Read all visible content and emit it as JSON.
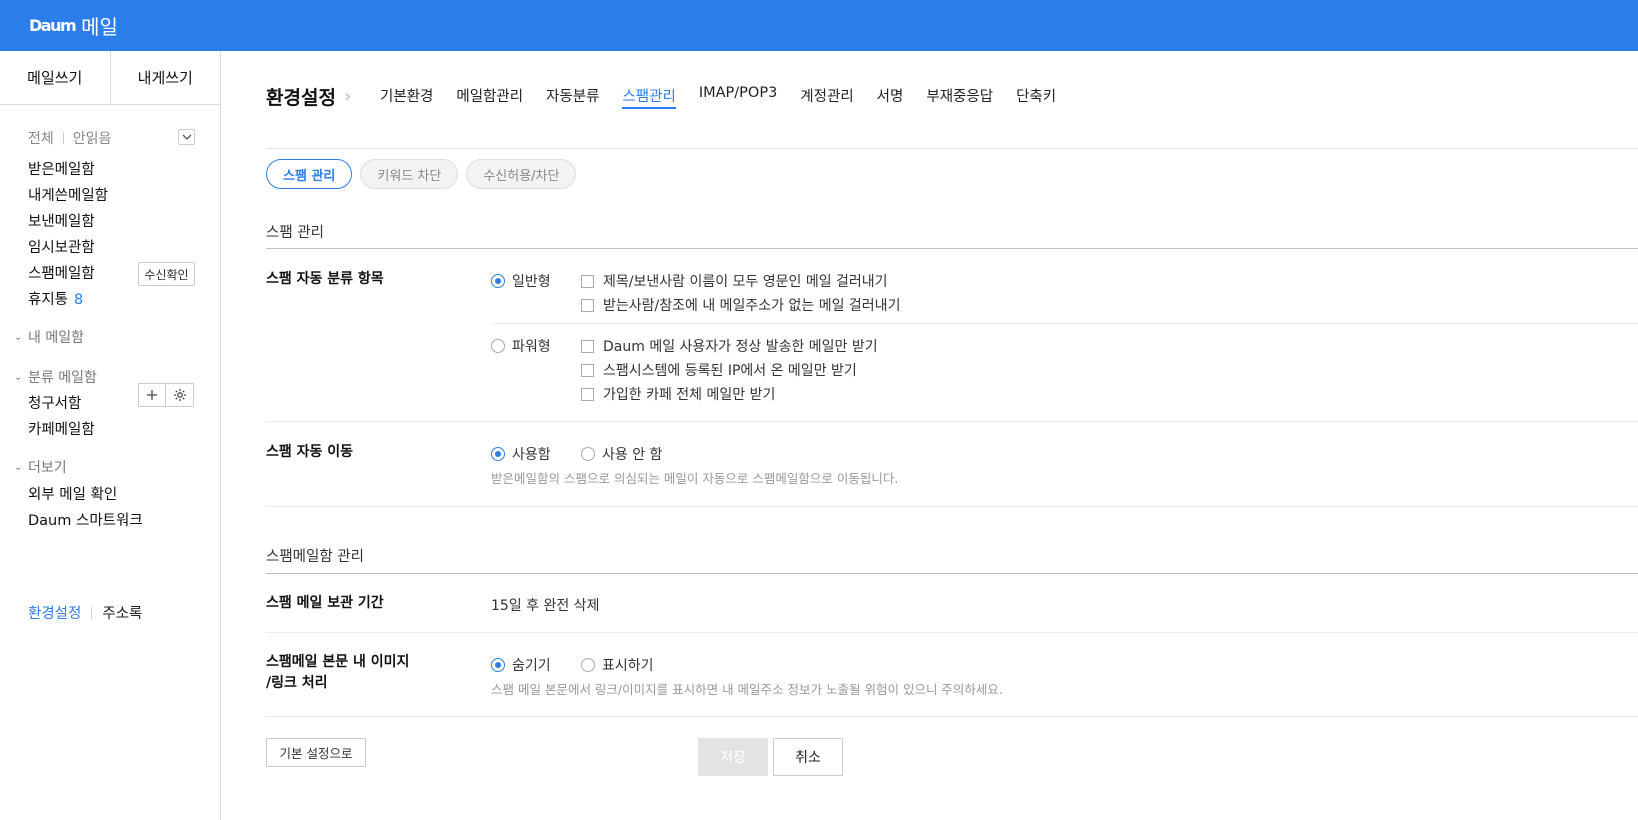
{
  "app": {
    "brand": "Daum",
    "title": "메일"
  },
  "sidebar": {
    "compose": [
      "메일쓰기",
      "내게쓰기"
    ],
    "filter": {
      "all": "전체",
      "unread": "안읽음"
    },
    "mailboxes": [
      {
        "label": "받은메일함"
      },
      {
        "label": "내게쓴메일함"
      },
      {
        "label": "보낸메일함"
      },
      {
        "label": "임시보관함"
      },
      {
        "label": "스팸메일함"
      },
      {
        "label": "휴지통",
        "count": "8"
      }
    ],
    "read_check": "수신확인",
    "my_mailbox": "내 메일함",
    "category_mailbox": "분류 메일함",
    "category_items": [
      "청구서함",
      "카페메일함"
    ],
    "more": "더보기",
    "more_items": [
      "외부 메일 확인",
      "Daum 스마트워크"
    ],
    "settings": "환경설정",
    "address_book": "주소록"
  },
  "header": {
    "title": "환경설정",
    "tabs": [
      "기본환경",
      "메일함관리",
      "자동분류",
      "스팸관리",
      "IMAP/POP3",
      "계정관리",
      "서명",
      "부재중응답",
      "단축키"
    ],
    "active_tab": "스팸관리"
  },
  "subtabs": [
    "스팸 관리",
    "키워드 차단",
    "수신허용/차단"
  ],
  "spam": {
    "section_title": "스팸 관리",
    "classify": {
      "label": "스팸 자동 분류 항목",
      "normal": "일반형",
      "normal_options": [
        "제목/보낸사람 이름이 모두 영문인 메일 걸러내기",
        "받는사람/참조에 내 메일주소가 없는 메일 걸러내기"
      ],
      "power": "파워형",
      "power_options": [
        "Daum 메일 사용자가 정상 발송한 메일만 받기",
        "스팸시스템에 등록된 IP에서 온 메일만 받기",
        "가입한 카페 전체 메일만 받기"
      ]
    },
    "move": {
      "label": "스팸 자동 이동",
      "use": "사용함",
      "no_use": "사용 안 함",
      "help": "받은메일함의 스팸으로 의심되는 메일이 자동으로 스팸메일함으로 이동됩니다."
    }
  },
  "spambox": {
    "section_title": "스팸메일함 관리",
    "retention": {
      "label": "스팸 메일 보관 기간",
      "value": "15일 후 완전 삭제"
    },
    "images": {
      "label_line1": "스팸메일 본문 내 이미지",
      "label_line2": "/링크 처리",
      "hide": "숨기기",
      "show": "표시하기",
      "help": "스팸 메일 본문에서 링크/이미지를 표시하면 내 메일주소 정보가 노출될 위험이 있으니 주의하세요."
    }
  },
  "actions": {
    "reset": "기본 설정으로",
    "save": "저장",
    "cancel": "취소"
  },
  "colors": {
    "accent": "#2b7de9"
  },
  "icons": {
    "filter_toggle": "chevron-down-icon",
    "add": "plus-icon",
    "settings": "gear-icon"
  }
}
